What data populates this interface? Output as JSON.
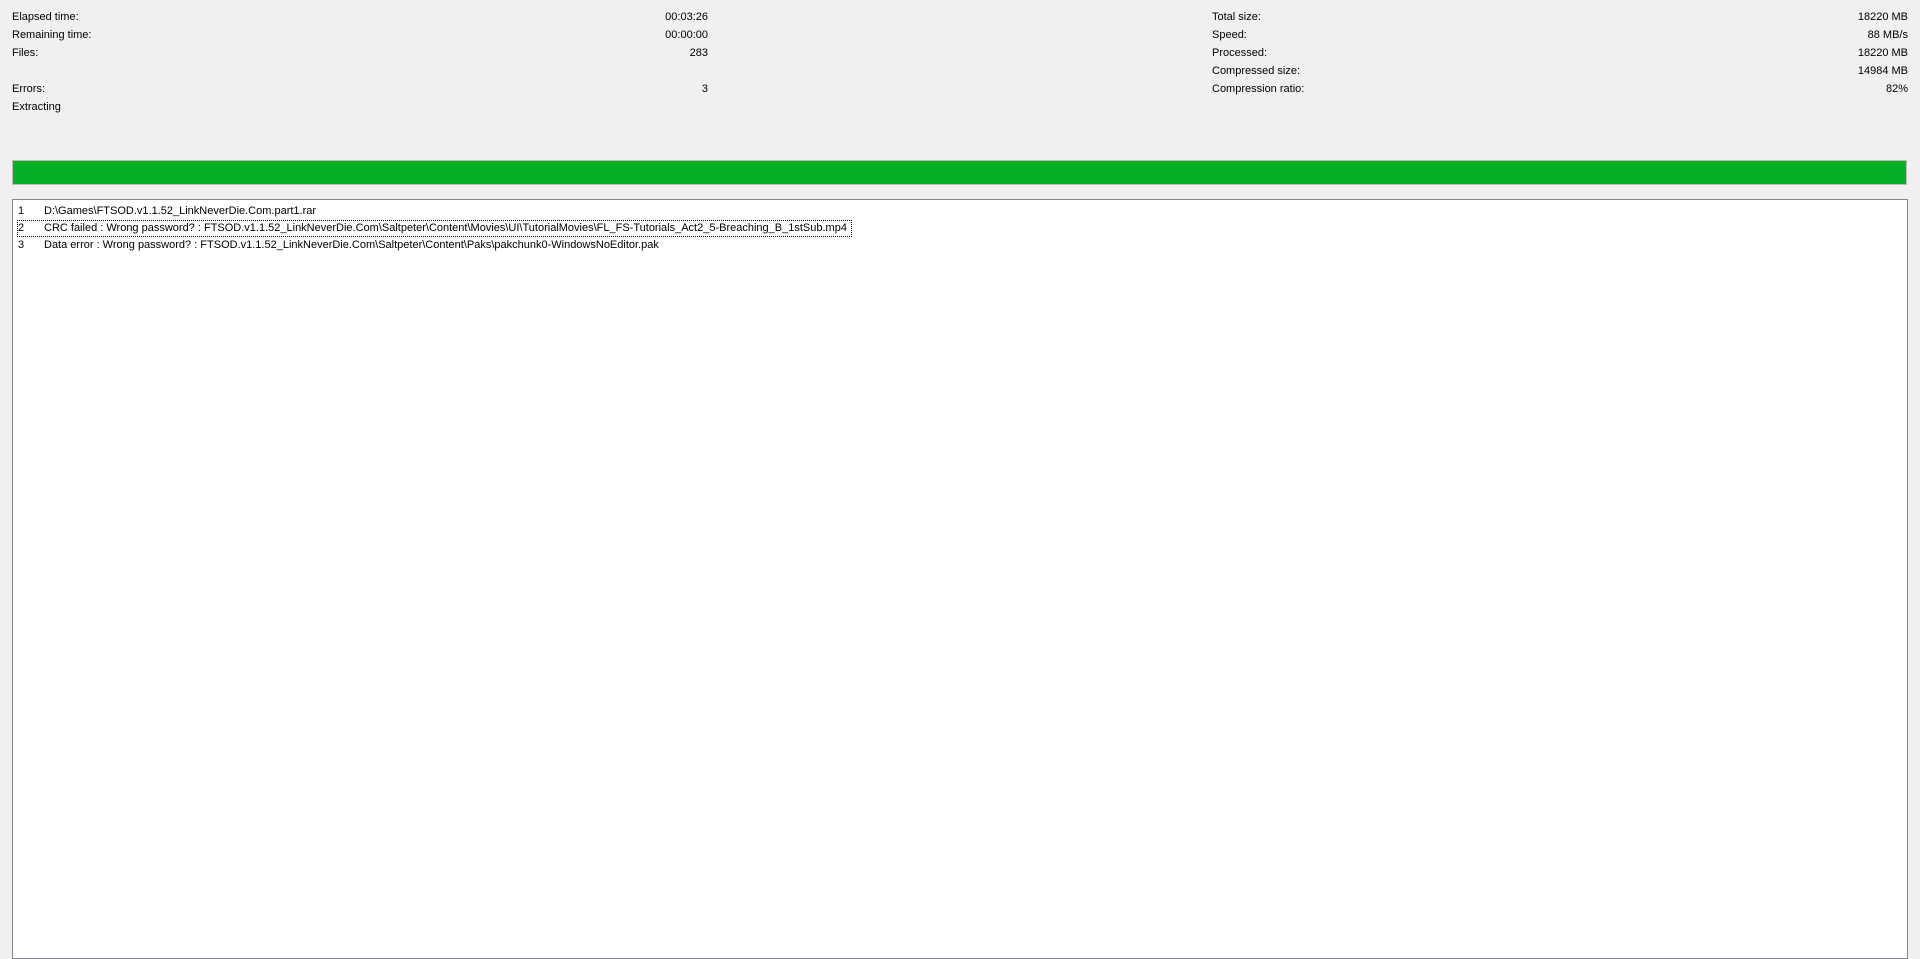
{
  "stats_left": [
    {
      "label": "Elapsed time:",
      "value": "00:03:26"
    },
    {
      "label": "Remaining time:",
      "value": "00:00:00"
    },
    {
      "label": "Files:",
      "value": "283"
    },
    {
      "label": "Errors:",
      "value": "3"
    }
  ],
  "stats_right": [
    {
      "label": "Total size:",
      "value": "18220 MB"
    },
    {
      "label": "Speed:",
      "value": "88 MB/s"
    },
    {
      "label": "Processed:",
      "value": "18220 MB"
    },
    {
      "label": "Compressed size:",
      "value": "14984 MB"
    },
    {
      "label": "Compression ratio:",
      "value": "82%"
    }
  ],
  "status": "Extracting",
  "progress": {
    "percent": 100,
    "color": "#06b025"
  },
  "log": [
    {
      "num": "1",
      "message": "D:\\Games\\FTSOD.v1.1.52_LinkNeverDie.Com.part1.rar"
    },
    {
      "num": "2",
      "message": "CRC failed : Wrong password? : FTSOD.v1.1.52_LinkNeverDie.Com\\Saltpeter\\Content\\Movies\\UI\\TutorialMovies\\FL_FS-Tutorials_Act2_5-Breaching_B_1stSub.mp4"
    },
    {
      "num": "3",
      "message": "Data error : Wrong password? : FTSOD.v1.1.52_LinkNeverDie.Com\\Saltpeter\\Content\\Paks\\pakchunk0-WindowsNoEditor.pak"
    }
  ]
}
